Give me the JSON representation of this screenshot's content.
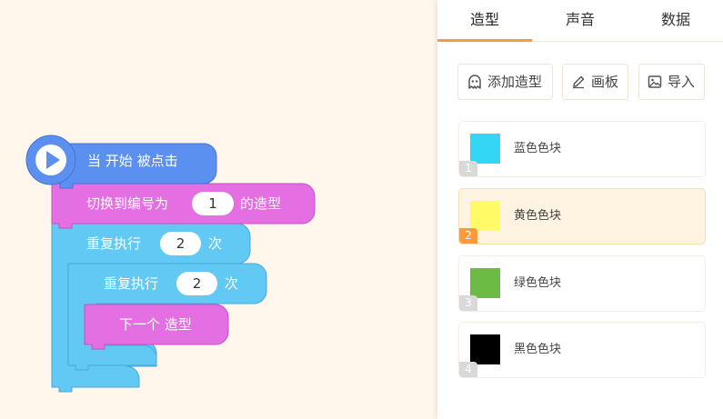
{
  "tabs": [
    {
      "label": "造型",
      "active": true
    },
    {
      "label": "声音",
      "active": false
    },
    {
      "label": "数据",
      "active": false
    }
  ],
  "toolbar": {
    "add_costume_label": "添加造型",
    "paint_label": "画板",
    "import_label": "导入"
  },
  "costumes": [
    {
      "number": "1",
      "name": "蓝色色块",
      "color": "#33d6f5",
      "selected": false
    },
    {
      "number": "2",
      "name": "黄色色块",
      "color": "#fffb66",
      "selected": true
    },
    {
      "number": "3",
      "name": "绿色色块",
      "color": "#6bbb44",
      "selected": false
    },
    {
      "number": "4",
      "name": "黑色色块",
      "color": "#000000",
      "selected": false
    }
  ],
  "script": {
    "hat": {
      "prefix": "当",
      "event": "开始",
      "suffix": "被点击"
    },
    "switch_costume": {
      "prefix": "切换到编号为",
      "value": "1",
      "suffix": "的造型"
    },
    "outer_repeat": {
      "prefix": "重复执行",
      "value": "2",
      "suffix": "次"
    },
    "inner_repeat": {
      "prefix": "重复执行",
      "value": "2",
      "suffix": "次"
    },
    "next_costume": {
      "prefix": "下一个",
      "suffix": "造型"
    }
  },
  "colors": {
    "events": "#5b8ff0",
    "looks": "#e36fe3",
    "control": "#62c9f5",
    "accent": "#ff9a3c",
    "canvas": "#fff6ec"
  }
}
